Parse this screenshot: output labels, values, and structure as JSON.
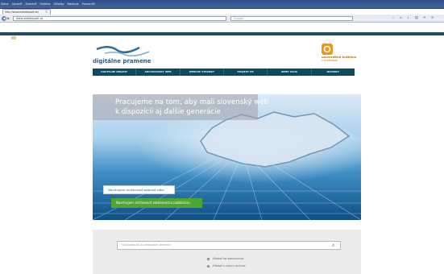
{
  "browser": {
    "menu": [
      "Súbor",
      "Upraviť",
      "Zobraziť",
      "História",
      "Záložky",
      "Nástroje",
      "Pomocník"
    ],
    "tab_title": "http://www.webdepozit.sk/",
    "new_tab": "+",
    "url": "www.webdepozit.sk",
    "search_placeholder": "Google",
    "toolbar_icons": [
      "star-icon",
      "home-icon",
      "download-icon",
      "bookmark-icon",
      "addon-icon",
      "menu-icon"
    ]
  },
  "site": {
    "logo_text": "digitálne pramene",
    "partner_name": "univerzitná knižnica",
    "partner_city": "v bratislave",
    "nav": [
      "DIGITÁLNE OBSAHY",
      "ARCHIVOVANÝ WEB",
      "WEBOVÉ STRÁNKY",
      "PROJEKT DP",
      "WEBY ZAOS",
      "NOVINKY"
    ],
    "hero": {
      "slogan_line1": "Pracujeme na tom, aby mali slovenský web",
      "slogan_line2": "k dispozícii aj ďalšie generácie",
      "button_web": "Navrhujem archivovať webové sídlo",
      "button_publication": "Navrhujem archivovať elektronickú publikáciu"
    },
    "search": {
      "placeholder": "Vyhľadávať vo webovom archíve",
      "option1": "Hľadať vo webarchíve",
      "option2": "Hľadať v celom archíve"
    }
  },
  "colors": {
    "nav_bg": "#0a4b62",
    "button_green": "#4ea52f",
    "partner_orange": "#e59a1c",
    "title_bar": "#2f4f88"
  }
}
